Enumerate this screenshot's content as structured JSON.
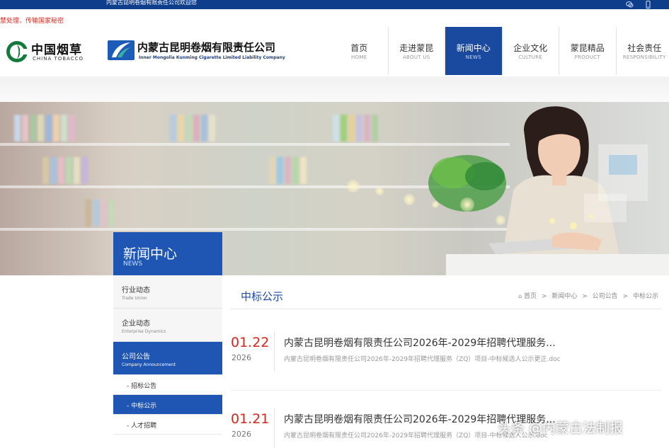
{
  "top_bar": {
    "site_name": "内蒙古昆明卷烟有限责任公司欢迎您",
    "icons": [
      "wechat-icon",
      "mobile-icon"
    ]
  },
  "notice_text": "禁处理、传输国家秘密",
  "logos": {
    "china_tobacco": {
      "cn": "中国烟草",
      "en": "CHINA TOBACCO"
    },
    "company": {
      "cn": "内蒙古昆明卷烟有限责任公司",
      "en": "Inner Mongolia Kunming Cigarette Limited Liability Company"
    }
  },
  "nav": [
    {
      "cn": "首页",
      "en": "HOME"
    },
    {
      "cn": "走进蒙昆",
      "en": "ABOUT US"
    },
    {
      "cn": "新闻中心",
      "en": "NEWS"
    },
    {
      "cn": "企业文化",
      "en": "CULTURE"
    },
    {
      "cn": "蒙昆精品",
      "en": "PRODUCT"
    },
    {
      "cn": "社会责任",
      "en": "RESPONSIBILITY"
    }
  ],
  "nav_active_index": 2,
  "sidebar": {
    "title": "新闻中心",
    "title_en": "NEWS",
    "items": [
      {
        "cn": "行业动态",
        "en": "Trade Union"
      },
      {
        "cn": "企业动态",
        "en": "Enterprise Dynamics"
      },
      {
        "cn": "公司公告",
        "en": "Company Announcement"
      }
    ],
    "subitems": [
      "- 招标公告",
      "- 中标公示",
      "- 人才招聘"
    ]
  },
  "content": {
    "title": "中标公示",
    "breadcrumb": [
      "首页",
      "新闻中心",
      "公司公告",
      "中标公示"
    ],
    "news": [
      {
        "date": "01.22",
        "year": "2026",
        "title": "内蒙古昆明卷烟有限责任公司2026年-2029年招聘代理服务...",
        "summary": "内蒙古昆明卷烟有限责任公司2026年-2029年招聘代理服务（ZQ）项目-中标候选人公示更正.doc"
      },
      {
        "date": "01.21",
        "year": "2026",
        "title": "内蒙古昆明卷烟有限责任公司2026年-2029年招聘代理服务...",
        "summary": "内蒙古昆明卷烟有限责任公司2026年-2029年招聘代理服务（ZQ）项目-中标候选人公示.doc"
      }
    ]
  },
  "watermark": "头条 @内蒙古法制报",
  "colors": {
    "primary_blue": "#1f55b3",
    "nav_blue": "#1a4aa0",
    "date_red": "#d7261c",
    "top_bar": "#0e3d8c"
  }
}
